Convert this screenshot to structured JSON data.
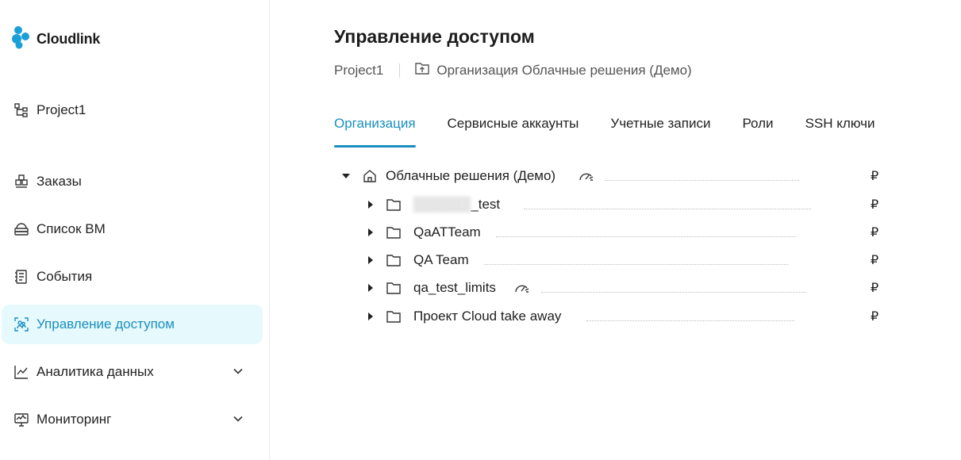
{
  "app": {
    "name": "Cloudlink"
  },
  "sidebar": {
    "project": "Project1",
    "items": [
      {
        "label": "Заказы",
        "icon": "orders-icon"
      },
      {
        "label": "Список ВМ",
        "icon": "vm-list-icon"
      },
      {
        "label": "События",
        "icon": "events-icon"
      },
      {
        "label": "Управление доступом",
        "icon": "access-icon",
        "active": true
      },
      {
        "label": "Аналитика данных",
        "icon": "analytics-icon",
        "expandable": true
      },
      {
        "label": "Мониторинг",
        "icon": "monitoring-icon",
        "expandable": true
      }
    ]
  },
  "page": {
    "title": "Управление доступом",
    "breadcrumb": {
      "project": "Project1",
      "organization": "Организация Облачные решения (Демо)"
    }
  },
  "tabs": [
    {
      "label": "Организация",
      "active": true
    },
    {
      "label": "Сервисные аккаунты"
    },
    {
      "label": "Учетные записи"
    },
    {
      "label": "Роли"
    },
    {
      "label": "SSH ключи"
    }
  ],
  "tree": {
    "currency": "₽",
    "root": {
      "label": "Облачные решения (Демо)",
      "has_limit": true,
      "expanded": true
    },
    "children": [
      {
        "label": "_test",
        "has_limit": false
      },
      {
        "label": "QaATTeam",
        "has_limit": false
      },
      {
        "label": "QA Team",
        "has_limit": false
      },
      {
        "label": "qa_test_limits",
        "has_limit": true
      },
      {
        "label": "Проект Cloud take away",
        "has_limit": false
      }
    ]
  },
  "colors": {
    "accent": "#1a8fbf",
    "active_bg": "#e6f9fd",
    "logo": "#1a9fd6"
  }
}
